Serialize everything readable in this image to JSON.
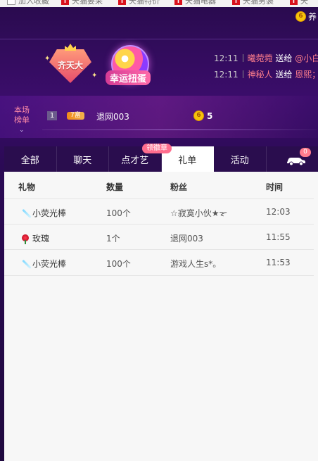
{
  "bookmarks": [
    "加入收藏",
    "天猫要采",
    "天猫特价",
    "天猫电器",
    "天猫男装",
    "天"
  ],
  "top": {
    "coin_glyph": "6",
    "label": "养"
  },
  "medal": {
    "label": "齐天大"
  },
  "egg": {
    "label": "幸运扭蛋"
  },
  "messages": [
    {
      "time": "12:11",
      "user": "曦菀菀",
      "action": "送给",
      "target": "@小白阳"
    },
    {
      "time": "12:11",
      "user": "神秘人",
      "action": "送给",
      "target": "恩熙；钅"
    }
  ],
  "rank": {
    "title": "本场榜单",
    "chevron": "⌄",
    "num": "1",
    "badge": "7富",
    "name": "退网003",
    "coin_glyph": "6",
    "value": "5"
  },
  "tabs": [
    {
      "label": "全部"
    },
    {
      "label": "聊天"
    },
    {
      "label": "点才艺"
    },
    {
      "label": "礼单"
    },
    {
      "label": "活动"
    }
  ],
  "tab_badge": "领徽章",
  "car_count": "0",
  "table": {
    "headers": [
      "礼物",
      "数量",
      "粉丝",
      "时间"
    ],
    "rows": [
      {
        "gift": "小荧光棒",
        "icon": "wand-icon",
        "qty": "100个",
        "fan": "☆寂寞小伙★ᯘ",
        "time": "12:03"
      },
      {
        "gift": "玫瑰",
        "icon": "rose-icon",
        "qty": "1个",
        "fan": "退网003",
        "time": "11:55"
      },
      {
        "gift": "小荧光棒",
        "icon": "wand-icon",
        "qty": "100个",
        "fan": "游戏人生s*。",
        "time": "11:53"
      }
    ]
  },
  "colors": {
    "accent": "#ff7f8c",
    "tab_active_bg": "#ffffff",
    "panel_bg": "#f7f7f7"
  }
}
